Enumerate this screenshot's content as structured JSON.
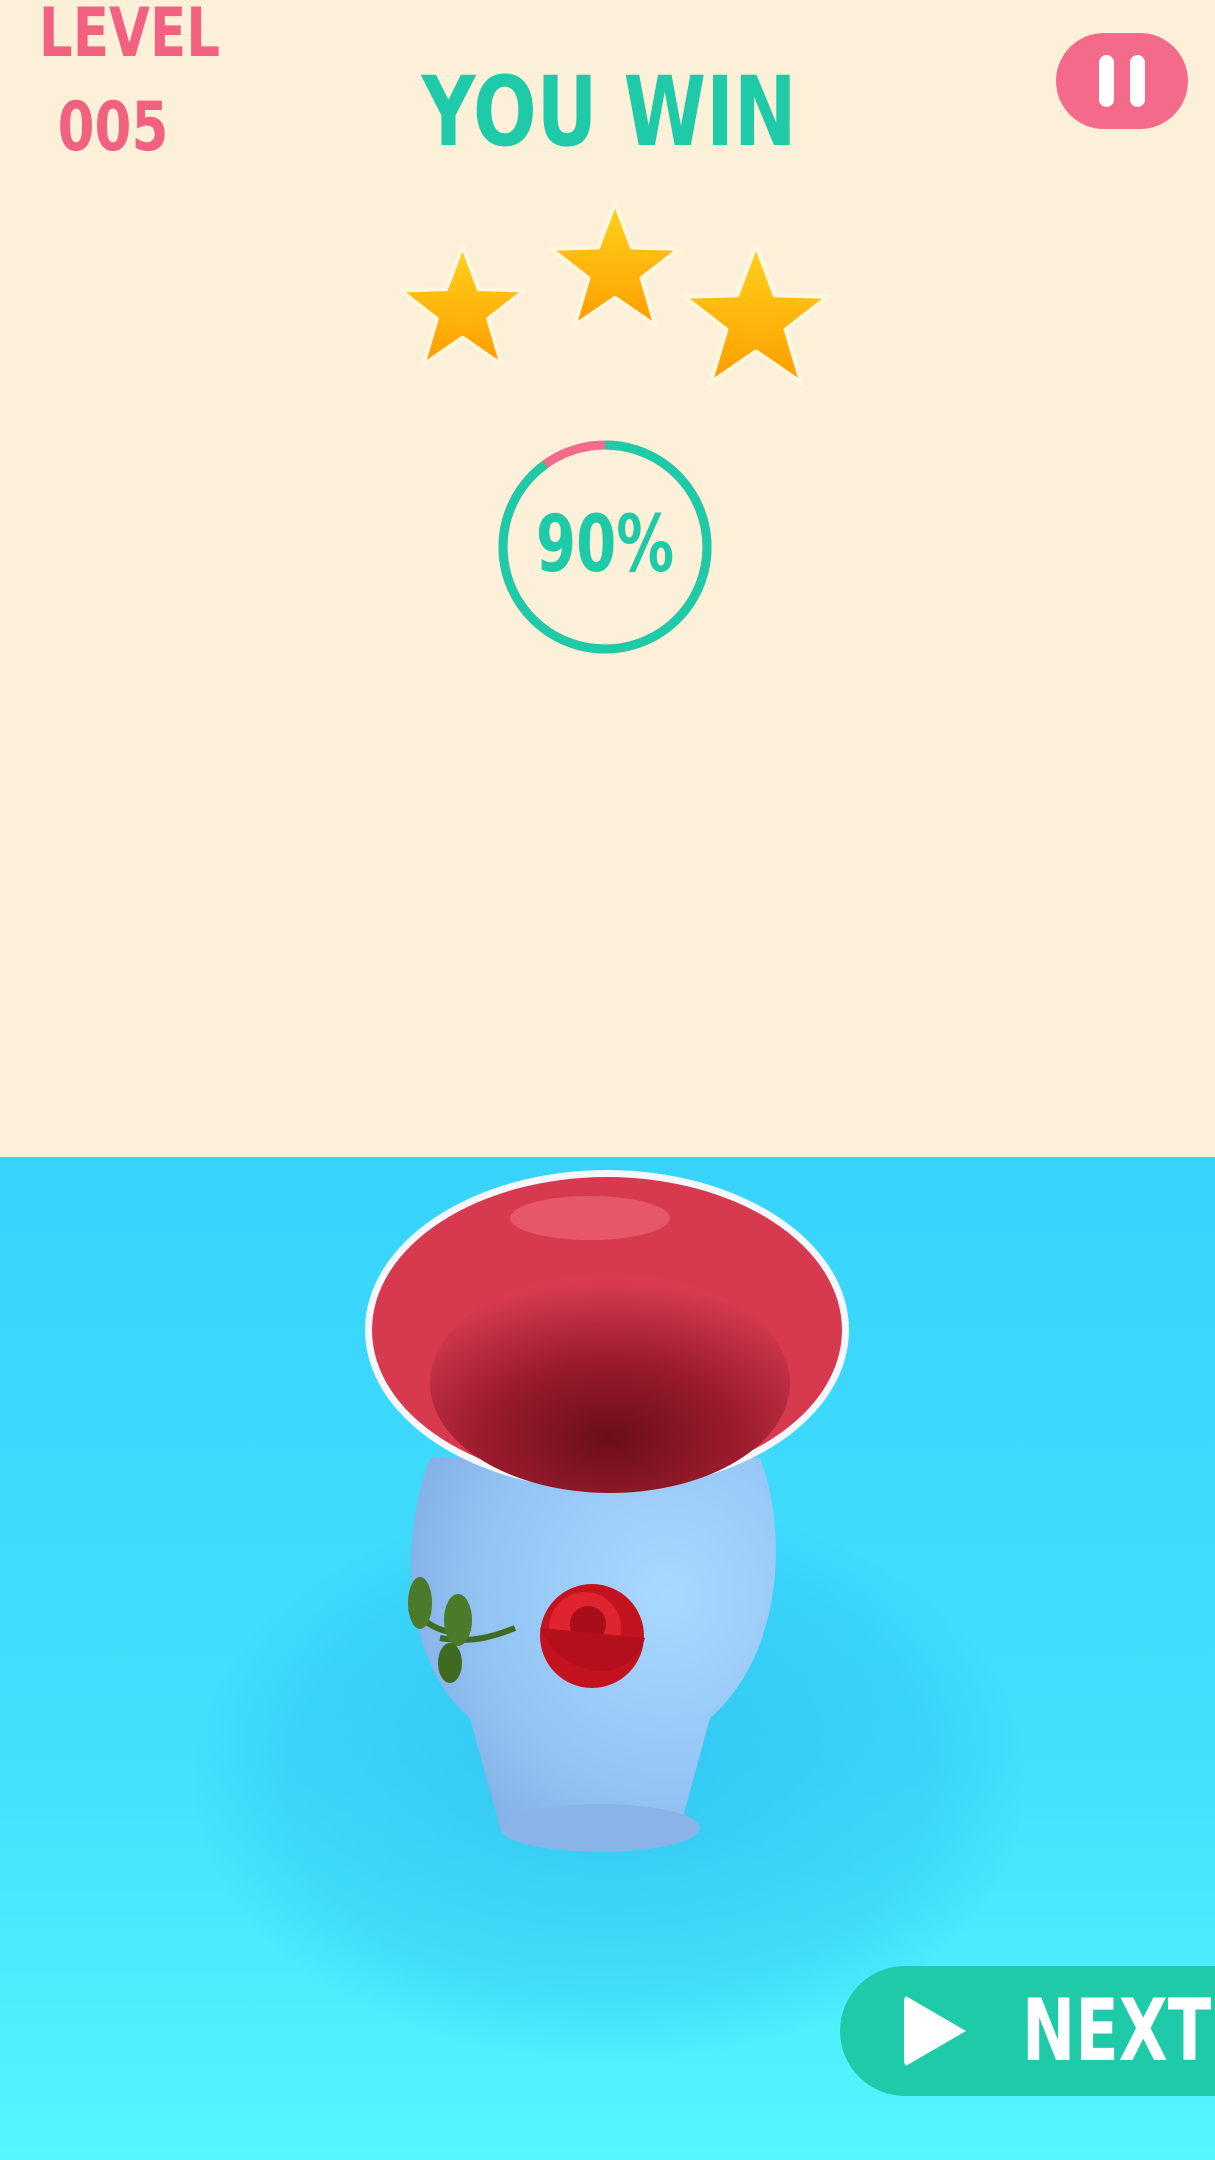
{
  "header": {
    "level_label": "LEVEL",
    "level_number": "005",
    "result_title": "YOU WIN"
  },
  "rating": {
    "stars_earned": 3,
    "stars_total": 3
  },
  "progress": {
    "value": 90,
    "display": "90%"
  },
  "buttons": {
    "next_label": "NEXT"
  },
  "icons": {
    "pause": "pause-icon",
    "play": "play-icon",
    "star": "star-icon"
  },
  "colors": {
    "background_top": "#fcf0d8",
    "floor": "#43e0fd",
    "accent_teal": "#1fcaa8",
    "accent_pink": "#f46a8b",
    "level_text": "#f2617f",
    "star": "#ffb300"
  }
}
